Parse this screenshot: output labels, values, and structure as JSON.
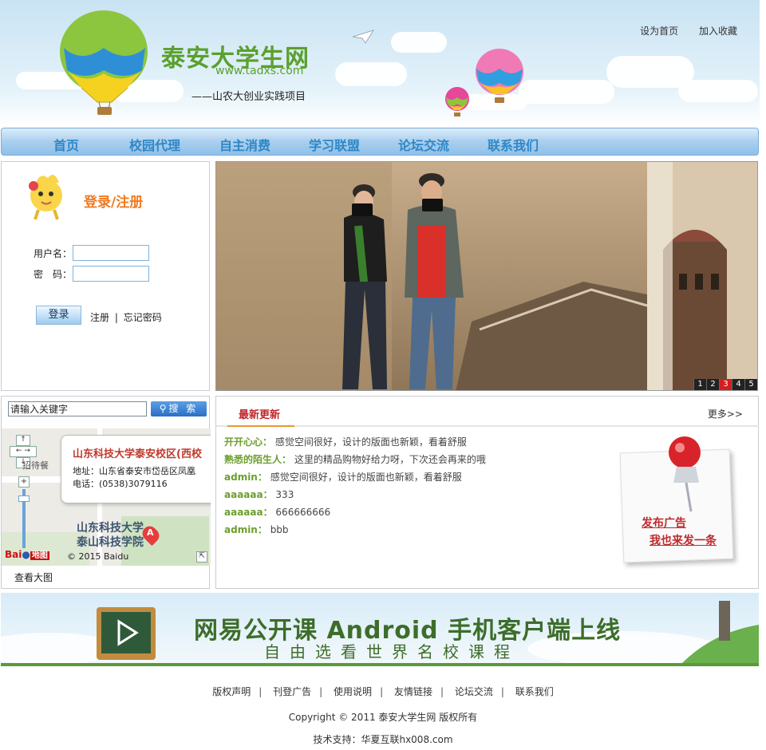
{
  "header": {
    "site_name": "泰安大学生网",
    "site_url": "www.tadxs.com",
    "tagline": "——山农大创业实践项目",
    "set_home": "设为首页",
    "add_favorite": "加入收藏"
  },
  "nav": [
    "首页",
    "校园代理",
    "自主消费",
    "学习联盟",
    "论坛交流",
    "联系我们"
  ],
  "login": {
    "title": "登录/注册",
    "username_label": "用户名：",
    "password_label": "密　码：",
    "login_button": "登录",
    "register": "注册",
    "separator": "|",
    "forgot": "忘记密码"
  },
  "slider": {
    "pages": [
      "1",
      "2",
      "3",
      "4",
      "5"
    ],
    "active_page": 3
  },
  "search": {
    "placeholder": "请输入关键字",
    "button": "搜 索"
  },
  "map": {
    "popup_title": "山东科技大学泰安校区(西校",
    "address": "地址：山东省泰安市岱岳区凤凰",
    "phone": "电话：(0538)3079116",
    "label_poi": "山东科技大学",
    "label_poi2": "泰山科技学院",
    "label_recruit": "招待餐",
    "marker": "A",
    "brand": "地图",
    "copyright": "© 2015 Baidu",
    "view_large": "查看大图"
  },
  "news": {
    "title": "最新更新",
    "more": "更多>>",
    "items": [
      {
        "user": "开开心心：",
        "text": "感觉空间很好，设计的版面也新颖，看着舒服"
      },
      {
        "user": "熟悉的陌生人：",
        "text": "这里的精品购物好给力呀，下次还会再来的哦"
      },
      {
        "user": "admin：",
        "text": "感觉空间很好，设计的版面也新颖，看着舒服"
      },
      {
        "user": "aaaaaa：",
        "text": "333"
      },
      {
        "user": "aaaaaa：",
        "text": "666666666"
      },
      {
        "user": "admin：",
        "text": "bbb"
      }
    ],
    "ad_line1": "发布广告",
    "ad_line2": "我也来发一条"
  },
  "banner": {
    "title": "网易公开课 Android 手机客户端上线",
    "subtitle": "自由选看世界名校课程"
  },
  "footer": {
    "links": [
      "版权声明",
      "刊登广告",
      "使用说明",
      "友情链接",
      "论坛交流",
      "联系我们"
    ],
    "copyright": "Copyright © 2011 泰安大学生网 版权所有",
    "support": "技术支持：华夏互联hx008.com"
  },
  "colors": {
    "nav_text": "#2f86c7",
    "brand_green": "#5aa02c",
    "accent_orange": "#f07a1f",
    "news_red": "#c0282c"
  }
}
